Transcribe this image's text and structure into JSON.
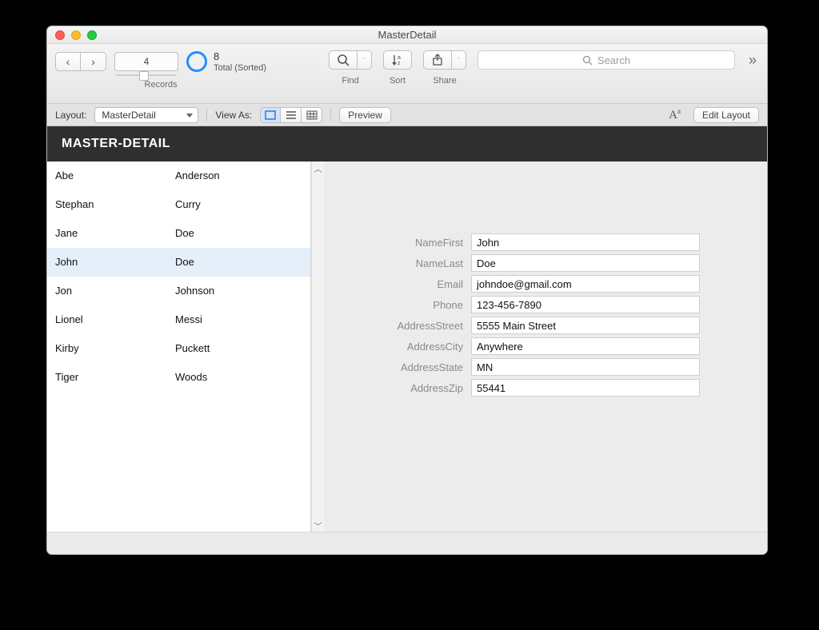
{
  "window": {
    "title": "MasterDetail"
  },
  "toolbar": {
    "record_current": "4",
    "record_total": "8",
    "record_status": "Total (Sorted)",
    "records_label": "Records",
    "find_label": "Find",
    "sort_label": "Sort",
    "share_label": "Share",
    "search_placeholder": "Search"
  },
  "layoutbar": {
    "layout_label": "Layout:",
    "layout_value": "MasterDetail",
    "viewas_label": "View As:",
    "preview_label": "Preview",
    "editlayout_label": "Edit Layout"
  },
  "header": {
    "title": "MASTER-DETAIL"
  },
  "master": {
    "rows": [
      {
        "first": "Abe",
        "last": "Anderson"
      },
      {
        "first": "Stephan",
        "last": "Curry"
      },
      {
        "first": "Jane",
        "last": "Doe"
      },
      {
        "first": "John",
        "last": "Doe"
      },
      {
        "first": "Jon",
        "last": "Johnson"
      },
      {
        "first": "Lionel",
        "last": "Messi"
      },
      {
        "first": "Kirby",
        "last": "Puckett"
      },
      {
        "first": "Tiger",
        "last": "Woods"
      }
    ],
    "selected_index": 3
  },
  "detail": {
    "fields": [
      {
        "label": "NameFirst",
        "value": "John"
      },
      {
        "label": "NameLast",
        "value": "Doe"
      },
      {
        "label": "Email",
        "value": "johndoe@gmail.com"
      },
      {
        "label": "Phone",
        "value": "123-456-7890"
      },
      {
        "label": "AddressStreet",
        "value": "5555 Main Street"
      },
      {
        "label": "AddressCity",
        "value": "Anywhere"
      },
      {
        "label": "AddressState",
        "value": "MN"
      },
      {
        "label": "AddressZip",
        "value": "55441"
      }
    ]
  }
}
